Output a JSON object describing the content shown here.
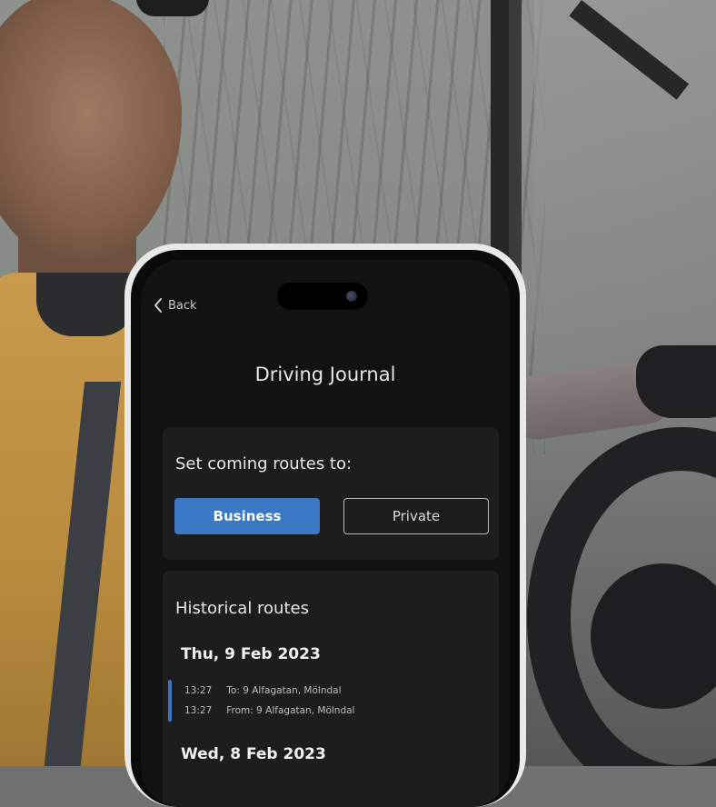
{
  "app": {
    "back_label": "Back",
    "title": "Driving Journal"
  },
  "set_routes": {
    "heading": "Set coming routes to:",
    "options": [
      "Business",
      "Private"
    ],
    "selected": "Business"
  },
  "history": {
    "heading": "Historical routes",
    "days": [
      {
        "date": "Thu, 9 Feb 2023",
        "routes": [
          {
            "time": "13:27",
            "label": "To: 9 Alfagatan, Mölndal"
          },
          {
            "time": "13:27",
            "label": "From: 9 Alfagatan, Mölndal"
          }
        ]
      },
      {
        "date": "Wed, 8 Feb 2023",
        "routes": []
      }
    ]
  },
  "colors": {
    "accent": "#3a78c6",
    "screen_bg": "#121212",
    "card_bg": "#1d1d1d"
  },
  "icons": {
    "back": "chevron-left-icon"
  }
}
